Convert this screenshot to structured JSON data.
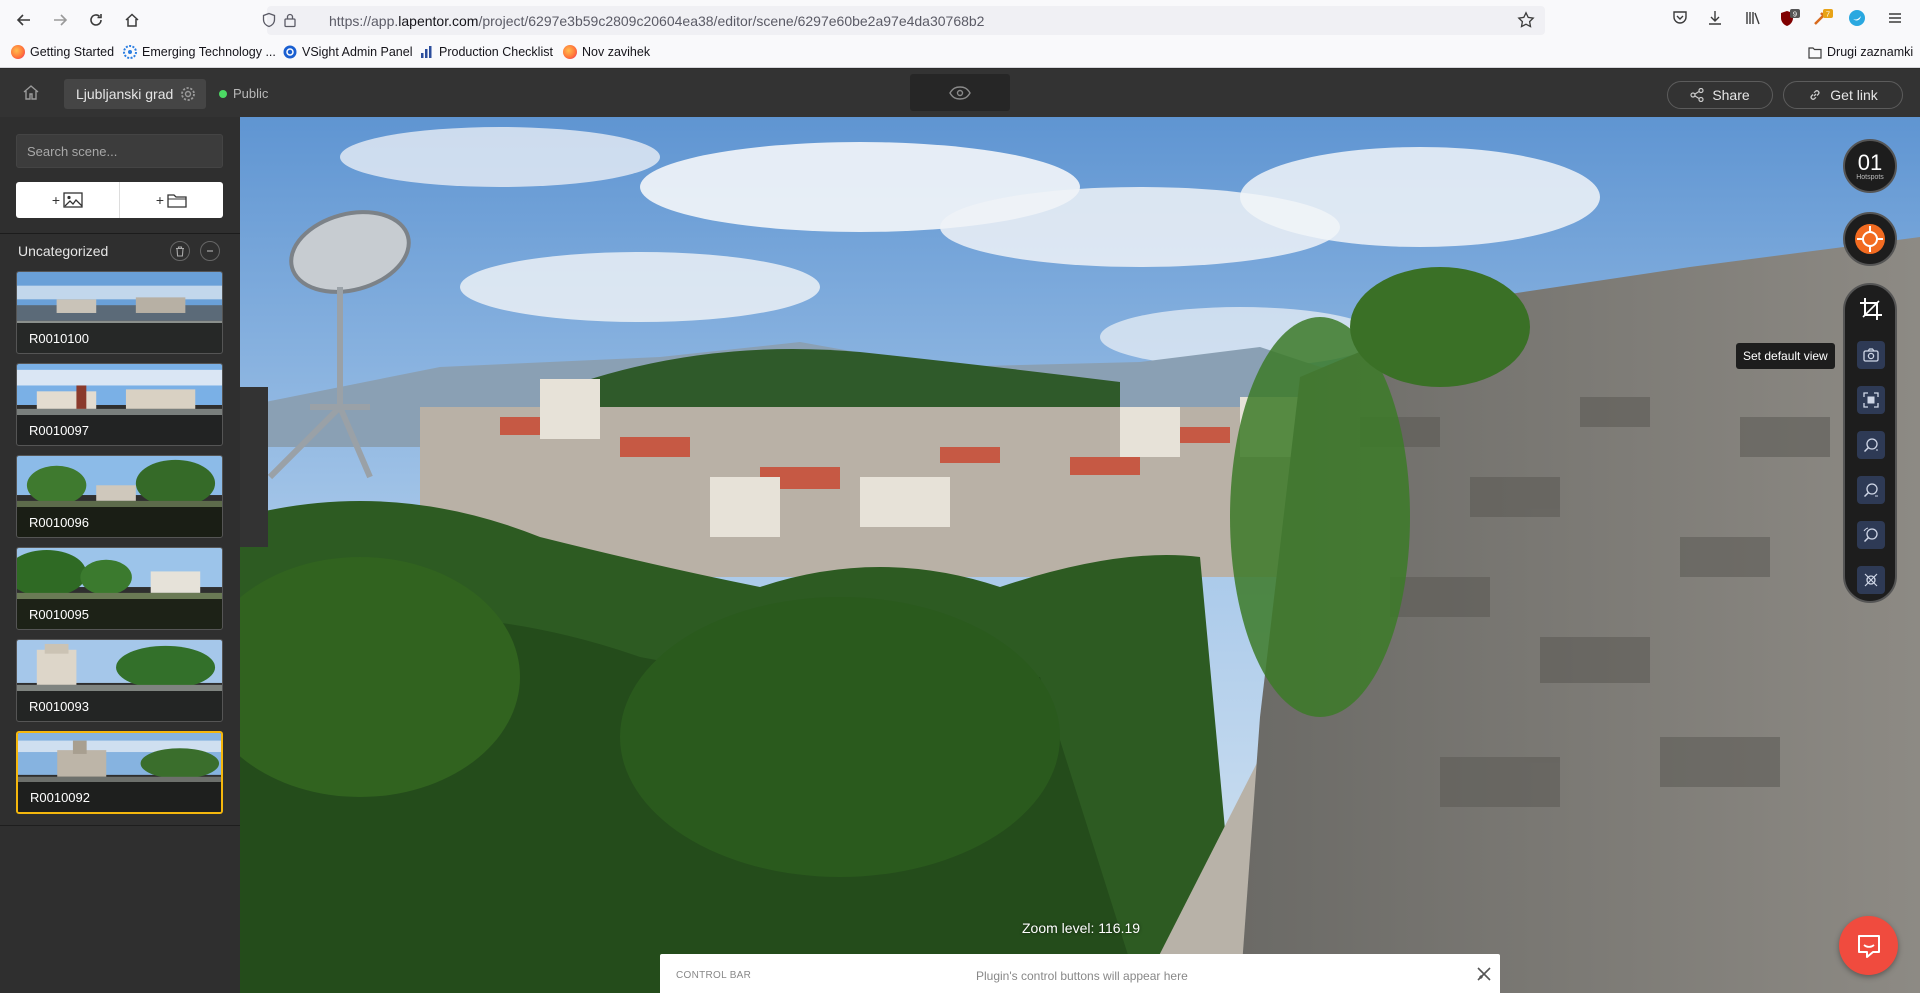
{
  "browser": {
    "url_prefix": "https://app.",
    "url_domain": "lapentor.com",
    "url_path": "/project/6297e3b59c2809c20604ea38/editor/scene/6297e60be2a97e4da30768b2",
    "bookmarks": [
      {
        "label": "Getting Started",
        "icon": "firefox-icon",
        "color": "#ff7139"
      },
      {
        "label": "Emerging Technology ...",
        "icon": "gear-flower-icon",
        "color": "#2a7de1"
      },
      {
        "label": "VSight Admin Panel",
        "icon": "vsight-icon",
        "color": "#1a5fd1"
      },
      {
        "label": "Production Checklist",
        "icon": "bar-chart-icon",
        "color": "#2b4d9c"
      },
      {
        "label": "Nov zavihek",
        "icon": "firefox-icon",
        "color": "#ff7139"
      }
    ],
    "other_bookmarks": "Drugi zaznamki",
    "badges": {
      "ublock": "9",
      "ext": "7"
    }
  },
  "appbar": {
    "project_name": "Ljubljanski grad",
    "visibility": "Public",
    "share_label": "Share",
    "get_link_label": "Get link"
  },
  "sidebar": {
    "search_placeholder": "Search scene...",
    "add_image_label": "+",
    "add_folder_label": "+",
    "group_title": "Uncategorized",
    "scenes": [
      {
        "name": "R0010100"
      },
      {
        "name": "R0010097"
      },
      {
        "name": "R0010096"
      },
      {
        "name": "R0010095"
      },
      {
        "name": "R0010093"
      },
      {
        "name": "R0010092",
        "active": true
      }
    ]
  },
  "viewer": {
    "hotspots_count": "01",
    "hotspots_caption": "Hotspots",
    "tooltip": "Set default view",
    "zoom_label": "Zoom level: 116.19",
    "control_bar_title": "CONTROL BAR",
    "control_bar_hint": "Plugin's control buttons will appear here"
  },
  "colors": {
    "accent_active": "#f5b70d",
    "chat": "#f04b3e",
    "public_dot": "#4cd964",
    "hotspot_orange": "#f26b21"
  }
}
